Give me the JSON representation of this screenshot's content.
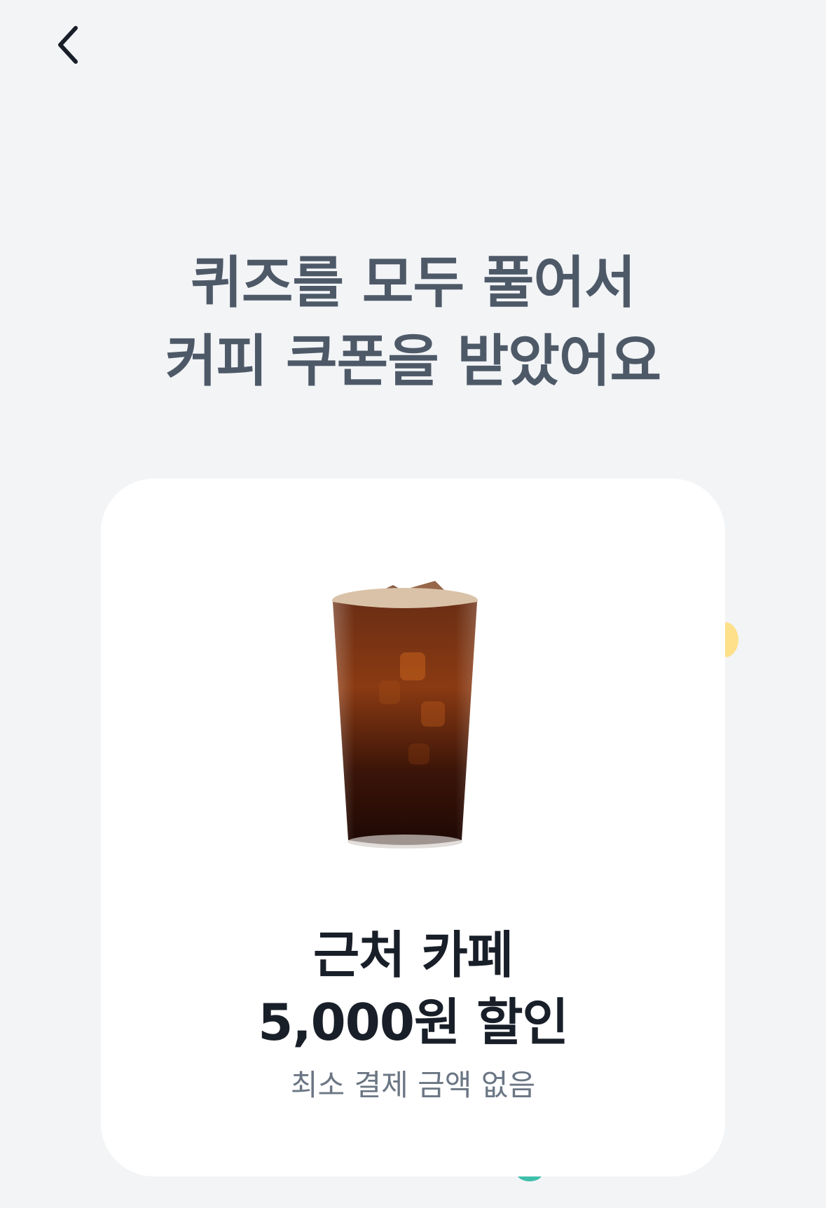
{
  "header": {
    "back_icon": "chevron-left-icon"
  },
  "headline": {
    "line1": "퀴즈를 모두 풀어서",
    "line2": "커피 쿠폰을 받았어요"
  },
  "coupon": {
    "image": "iced-americano-image",
    "title_line1": "근처 카페",
    "title_line2": "5,000원 할인",
    "note": "최소 결제 금액 없음"
  },
  "colors": {
    "background": "#f2f4f6",
    "card": "#ffffff",
    "headline_text": "#4e5968",
    "title_text": "#191f28",
    "note_text": "#6b7684",
    "confetti_yellow": "#ffe08a",
    "confetti_teal": "#3fbfaa"
  }
}
